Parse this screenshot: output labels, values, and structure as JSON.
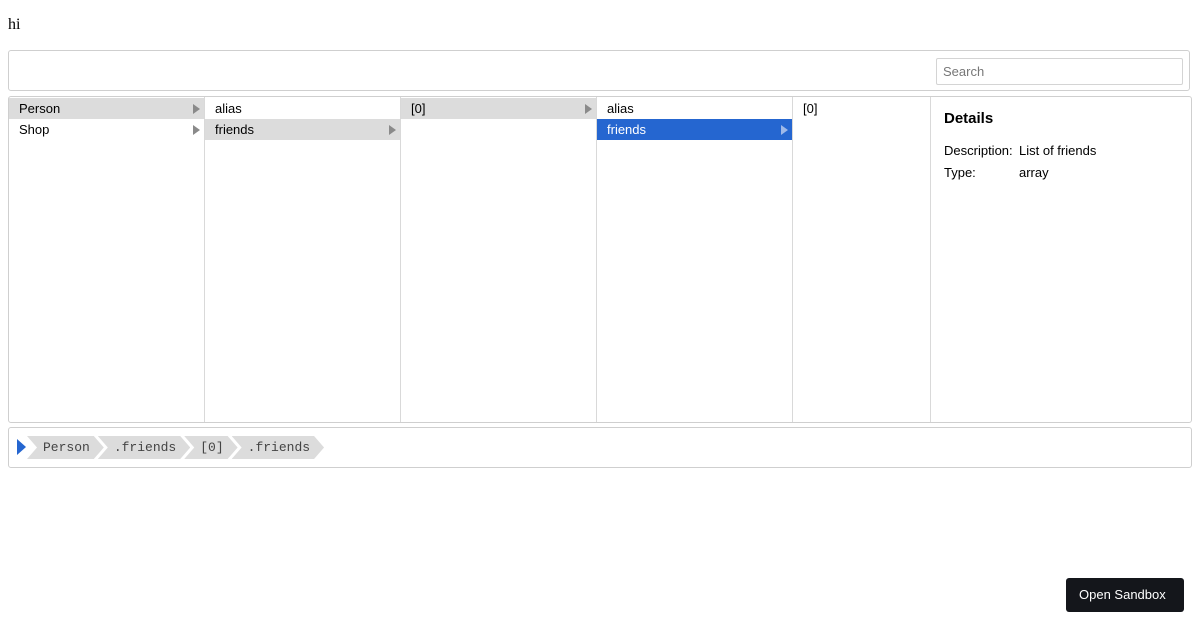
{
  "greeting": "hi",
  "search": {
    "placeholder": "Search",
    "value": ""
  },
  "columns": {
    "col1": [
      {
        "label": "Person",
        "has_children": true,
        "state": "highlighted"
      },
      {
        "label": "Shop",
        "has_children": true,
        "state": "normal"
      }
    ],
    "col2": [
      {
        "label": "alias",
        "has_children": false,
        "state": "normal"
      },
      {
        "label": "friends",
        "has_children": true,
        "state": "highlighted"
      }
    ],
    "col3": [
      {
        "label": "[0]",
        "has_children": true,
        "state": "highlighted"
      }
    ],
    "col4": [
      {
        "label": "alias",
        "has_children": false,
        "state": "normal"
      },
      {
        "label": "friends",
        "has_children": true,
        "state": "selected"
      }
    ],
    "col5": [
      {
        "label": "[0]",
        "has_children": false,
        "state": "normal"
      }
    ]
  },
  "details": {
    "title": "Details",
    "description_label": "Description:",
    "description_value": "List of friends",
    "type_label": "Type:",
    "type_value": "array"
  },
  "breadcrumb": [
    "Person",
    ".friends",
    "[0]",
    ".friends"
  ],
  "sandbox_button": "Open Sandbox",
  "colors": {
    "selected": "#2566d0",
    "highlight": "#dcdcdc",
    "button_bg": "#14161b"
  },
  "icons": {
    "item_arrow": "chevron-right-icon",
    "path_start": "play-triangle-icon"
  }
}
